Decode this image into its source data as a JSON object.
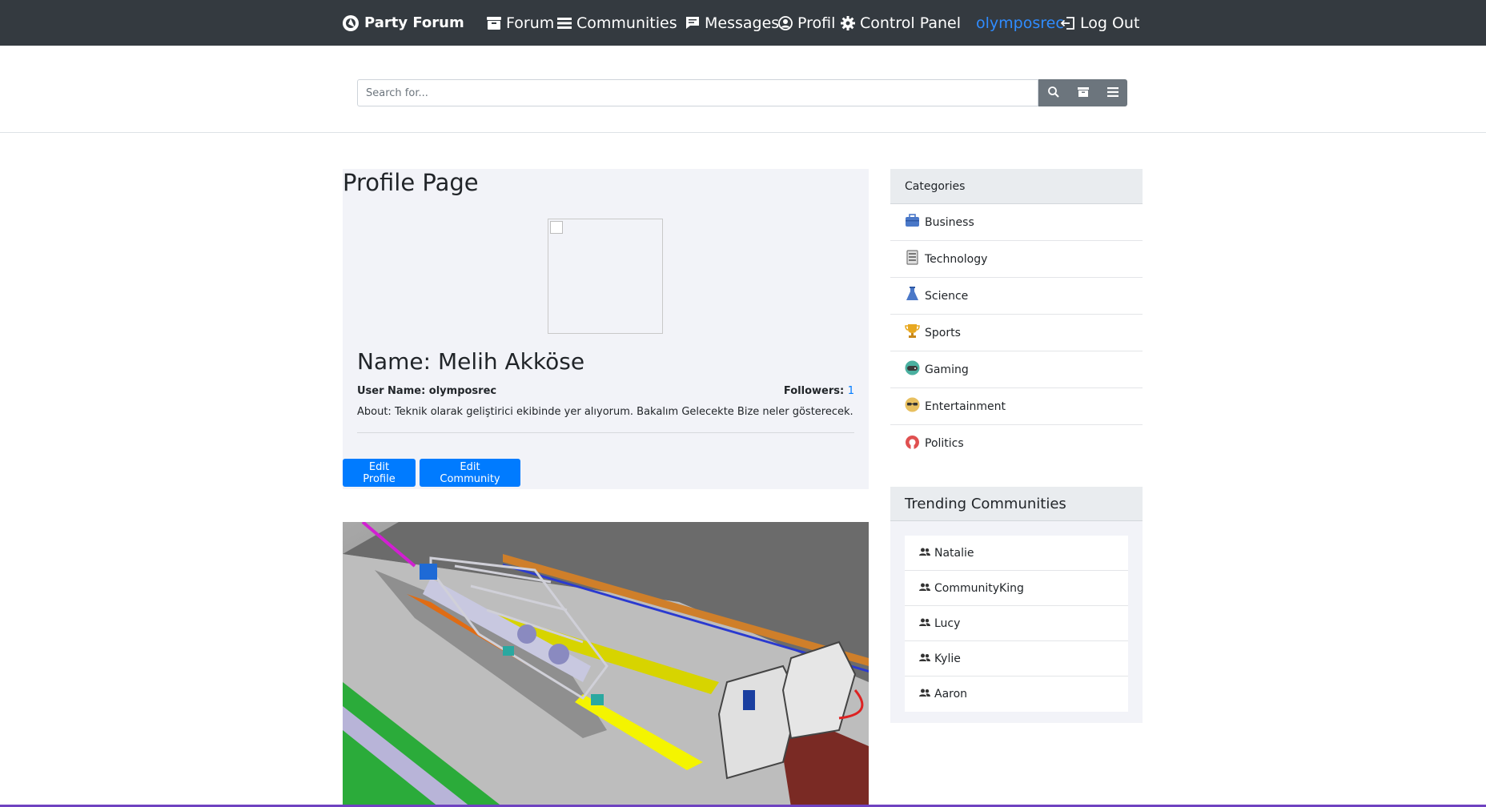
{
  "navbar": {
    "brand": "Party Forum",
    "items": [
      {
        "label": "Forum",
        "icon": "archive-icon"
      },
      {
        "label": "Communities",
        "icon": "list-icon"
      },
      {
        "label": "Messages",
        "icon": "message-icon"
      },
      {
        "label": "Profil",
        "icon": "user-circle-icon"
      },
      {
        "label": "Control Panel",
        "icon": "gear-icon"
      }
    ],
    "username": "olymposrec",
    "logout": "Log Out"
  },
  "search": {
    "placeholder": "Search for..."
  },
  "profile": {
    "page_title": "Profile Page",
    "name": "Name: Melih Akköse",
    "username_label": "User Name: olymposrec",
    "followers_label": "Followers:",
    "followers_count": "1",
    "about": "About: Teknik olarak geliştirici ekibinde yer alıyorum. Bakalım Gelecekte Bize neler gösterecek.",
    "edit_profile": "Edit Profile",
    "edit_community": "Edit Community"
  },
  "categories": {
    "header": "Categories",
    "items": [
      {
        "label": "Business",
        "icon": "briefcase-icon"
      },
      {
        "label": "Technology",
        "icon": "server-icon"
      },
      {
        "label": "Science",
        "icon": "flask-icon"
      },
      {
        "label": "Sports",
        "icon": "trophy-icon"
      },
      {
        "label": "Gaming",
        "icon": "gamepad-icon"
      },
      {
        "label": "Entertainment",
        "icon": "sunglasses-icon"
      },
      {
        "label": "Politics",
        "icon": "politics-icon"
      }
    ]
  },
  "trending": {
    "header": "Trending Communities",
    "items": [
      "Natalie",
      "CommunityKing",
      "Lucy",
      "Kylie",
      "Aaron"
    ]
  },
  "colors": {
    "navbar_bg": "#343a40",
    "accent": "#007bff",
    "username_link": "#2f8cff",
    "card_bg": "#f2f3f8",
    "bottom_bar": "#6f42c1"
  }
}
